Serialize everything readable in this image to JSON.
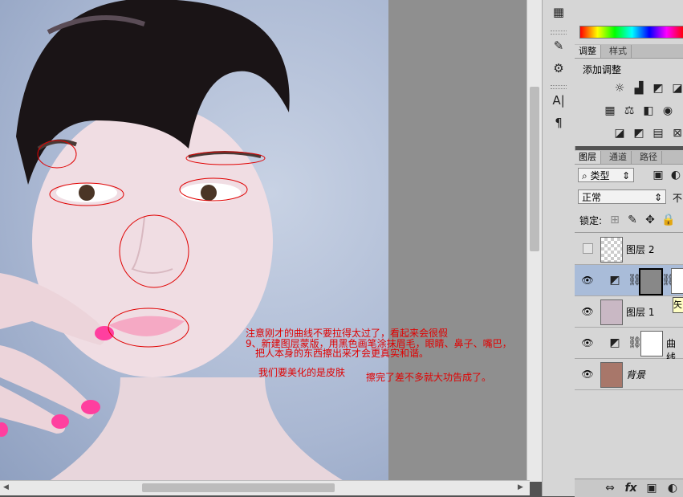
{
  "tools": {
    "items": [
      "layers-icon",
      "brush-preset-icon",
      "clone-source-icon",
      "character-icon",
      "paragraph-icon"
    ],
    "glyphs": [
      "▦",
      "✎",
      "⚙",
      "A|",
      "¶"
    ]
  },
  "adjustments": {
    "tabs": [
      "调整",
      "样式"
    ],
    "title": "添加调整"
  },
  "layers_panel": {
    "tabs": [
      "图层",
      "通道",
      "路径"
    ],
    "filter_kind": "类型",
    "blend_mode": "正常",
    "opacity_label": "不",
    "lock_label": "锁定:",
    "layers": [
      {
        "name": "图层 2",
        "visible": false
      },
      {
        "name": "",
        "visible": true,
        "selected": true
      },
      {
        "name": "图层 1",
        "visible": true
      },
      {
        "name": "曲线",
        "visible": true
      },
      {
        "name": "背景",
        "visible": true
      }
    ],
    "tooltip": "矢",
    "bottom_icons": [
      "⇔",
      "fx",
      "▣",
      "◐"
    ]
  },
  "annotations": {
    "line1": "注意刚才的曲线不要拉得太过了，看起来会很假",
    "line2": "9、新建图层蒙版，用黑色画笔涂抹眉毛，眼睛、鼻子、嘴巴，",
    "line3": "把人本身的东西擦出来才会更真实和谐。",
    "line4": "我们要美化的是皮肤",
    "line5": "擦完了差不多就大功告成了。"
  },
  "colors": {
    "annotation_red": "#e00000",
    "selected_layer": "#a9bcd9",
    "panel_bg": "#d6d6d6"
  }
}
